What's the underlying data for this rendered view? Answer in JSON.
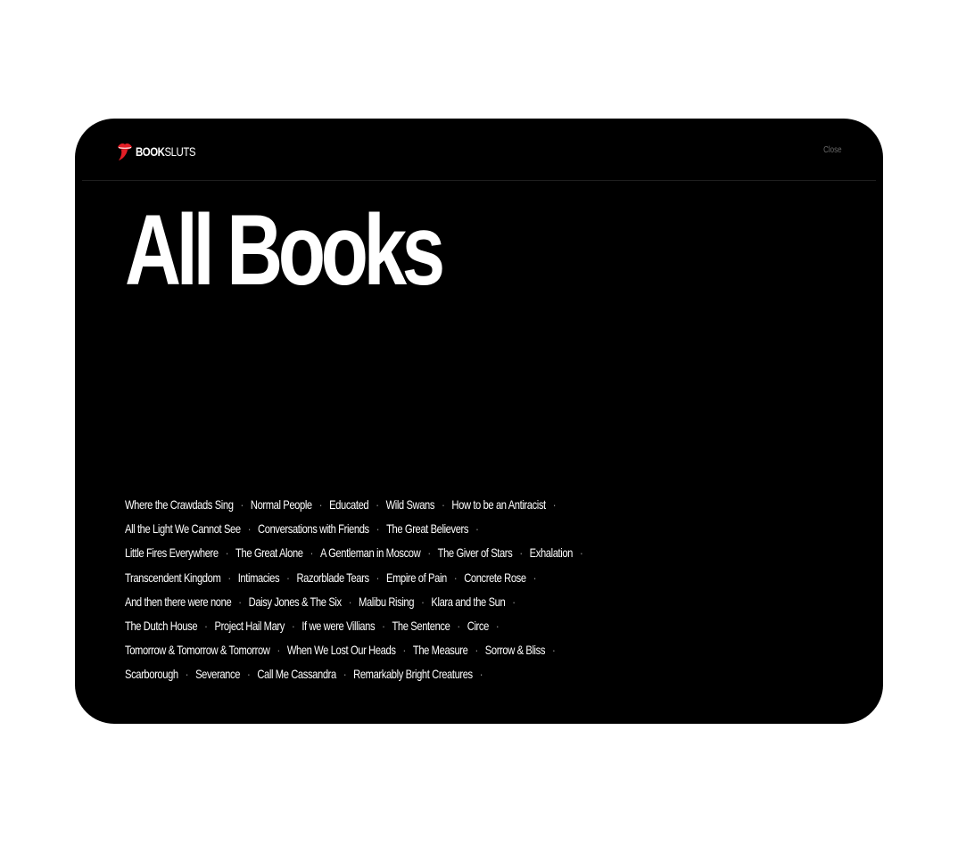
{
  "header": {
    "logo_text_bold": "BOOK",
    "logo_text_light": "SLUTS",
    "logo_icon": "lips-tongue-icon",
    "close_label": "Close"
  },
  "page": {
    "title": "All Books"
  },
  "separator": "·",
  "colors": {
    "background": "#000000",
    "text": "#ffffff",
    "logo_accent": "#e41e26",
    "muted": "#6a6a6a"
  },
  "books": [
    [
      "Where the Crawdads Sing",
      "Normal People",
      "Educated",
      "Wild Swans",
      "How to be an Antiracist"
    ],
    [
      "All the Light We Cannot See",
      "Conversations with Friends",
      "The Great Believers"
    ],
    [
      "Little Fires Everywhere",
      "The Great Alone",
      "A Gentleman in Moscow",
      "The Giver of Stars",
      "Exhalation"
    ],
    [
      "Transcendent Kingdom",
      "Intimacies",
      "Razorblade Tears",
      "Empire of Pain",
      "Concrete Rose"
    ],
    [
      "And then there were none",
      "Daisy Jones & The Six",
      "Malibu Rising",
      "Klara and the Sun"
    ],
    [
      "The Dutch House",
      "Project Hail Mary",
      "If we were Villians",
      "The Sentence",
      "Circe"
    ],
    [
      "Tomorrow & Tomorrow & Tomorrow",
      "When We Lost Our Heads",
      "The Measure",
      "Sorrow & Bliss"
    ],
    [
      "Scarborough",
      "Severance",
      "Call Me Cassandra",
      "Remarkably Bright Creatures"
    ]
  ]
}
